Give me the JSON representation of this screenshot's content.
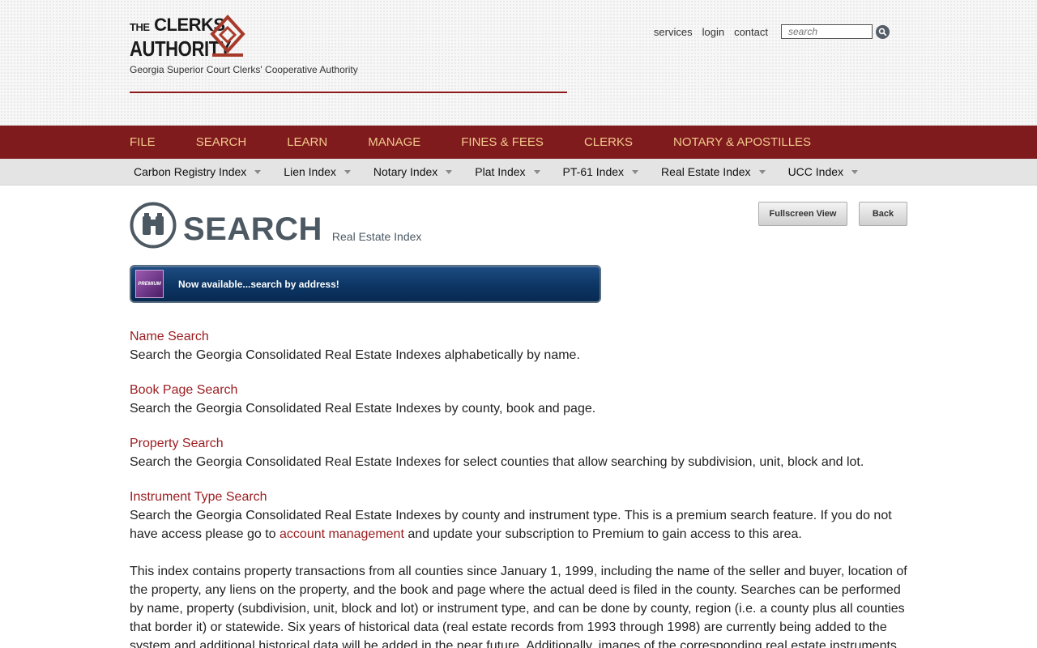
{
  "header": {
    "logo_line1_the": "THE",
    "logo_line1": "CLERKS",
    "logo_line2": "AUTHORITY",
    "tagline": "Georgia Superior Court Clerks' Cooperative Authority",
    "links": [
      "services",
      "login",
      "contact"
    ],
    "search_placeholder": "search"
  },
  "main_nav": [
    "FILE",
    "SEARCH",
    "LEARN",
    "MANAGE",
    "FINES & FEES",
    "CLERKS",
    "NOTARY & APOSTILLES"
  ],
  "sub_nav": [
    "Carbon Registry Index",
    "Lien Index",
    "Notary Index",
    "Plat Index",
    "PT-61 Index",
    "Real Estate Index",
    "UCC Index"
  ],
  "page": {
    "title": "SEARCH",
    "subtitle": "Real Estate Index",
    "fullscreen_label": "Fullscreen View",
    "back_label": "Back"
  },
  "banner": {
    "badge": "PREMIUM",
    "text": "Now available...search by address!"
  },
  "sections": [
    {
      "title": "Name Search",
      "desc": "Search the Georgia Consolidated Real Estate Indexes alphabetically by name."
    },
    {
      "title": "Book Page Search",
      "desc": "Search the Georgia Consolidated Real Estate Indexes by county, book and page."
    },
    {
      "title": "Property Search",
      "desc": "Search the Georgia Consolidated Real Estate Indexes for select counties that allow searching by subdivision, unit, block and lot."
    },
    {
      "title": "Instrument Type Search",
      "desc_before": "Search the Georgia Consolidated Real Estate Indexes by county and instrument type. This is a premium search feature. If you do not have access please go to",
      "link": "account management",
      "desc_after": "and update your subscription to Premium to gain access to this area."
    }
  ],
  "about": "This index contains property transactions from all counties since January 1, 1999, including the name of the seller and buyer, location of the property, any liens on the property, and the book and page where the actual deed is filed in the county. Searches can be performed by name, property (subdivision, unit, block and lot) or instrument type, and can be done by county, region (i.e. a county plus all counties that border it) or statewide. Six years of historical data (real estate records from 1993 through 1998) are currently being added to the system and additional historical data will be added in the near future. Additionally, images of the corresponding real estate instruments",
  "colors": {
    "nav_bg": "#7f1a1d",
    "nav_text": "#f3c98c",
    "link": "#9a1c1f",
    "title": "#4c5862",
    "banner": "#0d3766"
  }
}
